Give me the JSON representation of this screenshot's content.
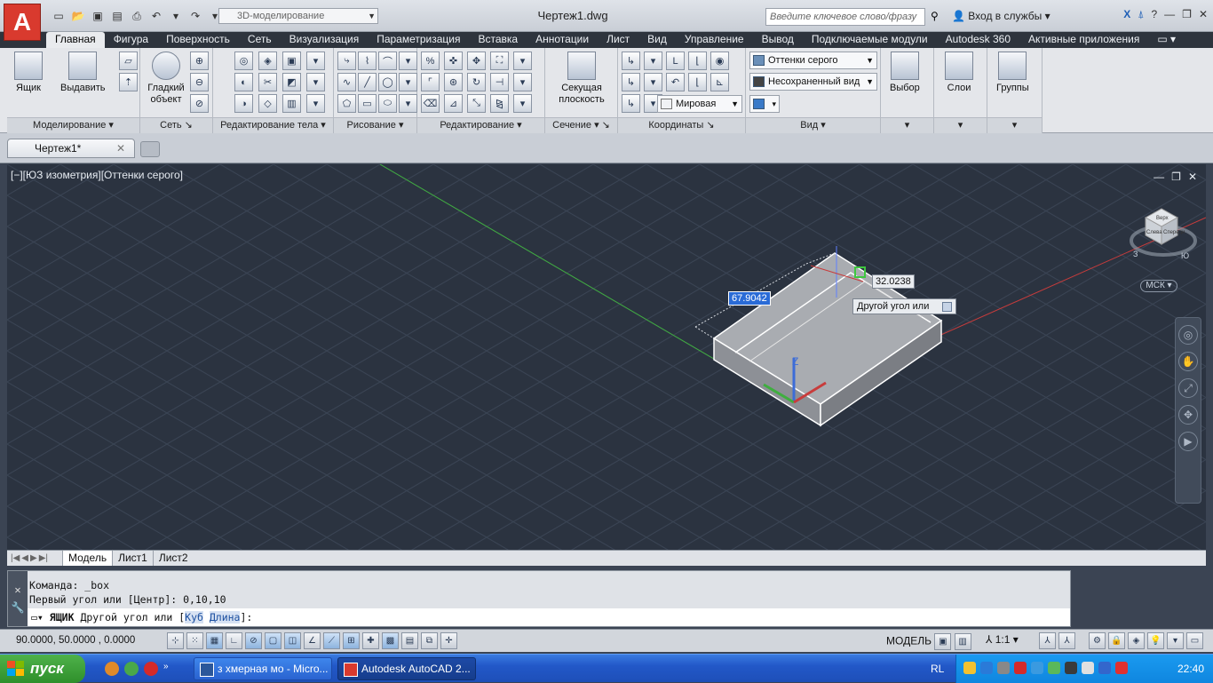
{
  "titlebar": {
    "workspace": "3D-моделирование",
    "document_title": "Чертеж1.dwg",
    "search_placeholder": "Введите ключевое слово/фразу",
    "login": "Вход в службы"
  },
  "ribbon_tabs": [
    "Главная",
    "Фигура",
    "Поверхность",
    "Сеть",
    "Визуализация",
    "Параметризация",
    "Вставка",
    "Аннотации",
    "Лист",
    "Вид",
    "Управление",
    "Вывод",
    "Подключаемые модули",
    "Autodesk 360",
    "Активные приложения"
  ],
  "ribbon_active_tab": "Главная",
  "panels": {
    "modeling": {
      "label": "Моделирование",
      "box": "Ящик",
      "extrude": "Выдавить"
    },
    "mesh": {
      "label": "Сеть",
      "smooth": "Гладкий объект"
    },
    "solid_edit": {
      "label": "Редактирование тела"
    },
    "draw": {
      "label": "Рисование"
    },
    "modify": {
      "label": "Редактирование"
    },
    "section": {
      "label": "Сечение",
      "plane": "Секущая плоскость"
    },
    "coordinates": {
      "label": "Координаты",
      "world": "Мировая"
    },
    "view": {
      "label": "Вид",
      "visual_style": "Оттенки серого",
      "named_view": "Несохраненный вид"
    },
    "selection": {
      "label": "Выбор"
    },
    "layers": {
      "label": "Слои"
    },
    "groups": {
      "label": "Группы"
    }
  },
  "file_tab": "Чертеж1*",
  "viewport": {
    "label": "[−][ЮЗ изометрия][Оттенки серого]",
    "dim_length": "67.9042",
    "dim_angle": "32.0238",
    "prompt_tooltip": "Другой угол или",
    "ucs": "МСК",
    "viewcube_faces": {
      "top": "Верх",
      "front": "Спереди",
      "left": "Слева"
    },
    "compass": {
      "south": "Ю",
      "west": "З"
    }
  },
  "layout_tabs": [
    "Модель",
    "Лист1",
    "Лист2"
  ],
  "command": {
    "line1": "Команда: _box",
    "line2": "Первый угол или [Центр]: 0,10,10",
    "input_prefix": "ЯЩИК",
    "input_text": "Другой угол или [",
    "option_cube": "Куб",
    "option_length": "Длина",
    "input_suffix": "]:"
  },
  "status": {
    "coords": "90.0000,  50.0000 ,  0.0000",
    "model": "МОДЕЛЬ",
    "scale": "1:1"
  },
  "taskbar": {
    "start": "пуск",
    "task1": "з хмерная мо - Micro...",
    "task2": "Autodesk AutoCAD 2...",
    "lang": "RL",
    "clock": "22:40"
  },
  "colors": {
    "viewport_bg": "#2b3340",
    "ribbon_tab_bg": "#2e343d",
    "x_axis": "#c83c3c",
    "y_axis": "#3fae3f",
    "z_axis": "#3c6cd8"
  }
}
